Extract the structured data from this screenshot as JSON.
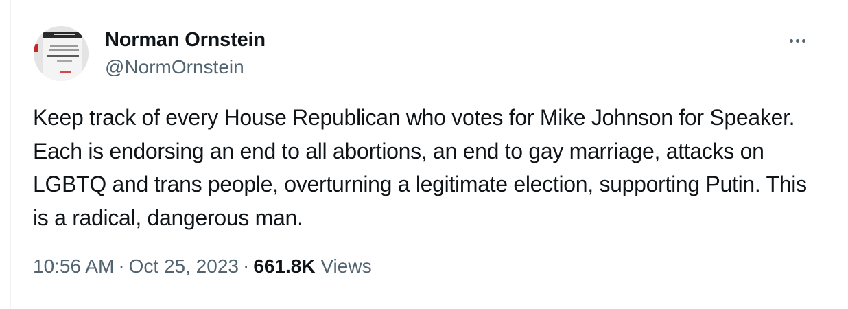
{
  "author": {
    "name": "Norman Ornstein",
    "handle": "@NormOrnstein"
  },
  "tweet": {
    "text": "Keep track of every House Republican who votes for Mike Johnson for Speaker. Each is endorsing an end to all abortions, an end to gay marriage, attacks on LGBTQ and trans people, overturning a legitimate election, supporting Putin. This is a radical, dangerous man."
  },
  "meta": {
    "time": "10:56 AM",
    "separator": "·",
    "date": "Oct 25, 2023",
    "views_count": "661.8K",
    "views_label": "Views"
  },
  "icons": {
    "more": "more-horizontal-icon"
  },
  "colors": {
    "text_primary": "#0f1419",
    "text_secondary": "#536471",
    "border": "#eff3f4"
  }
}
